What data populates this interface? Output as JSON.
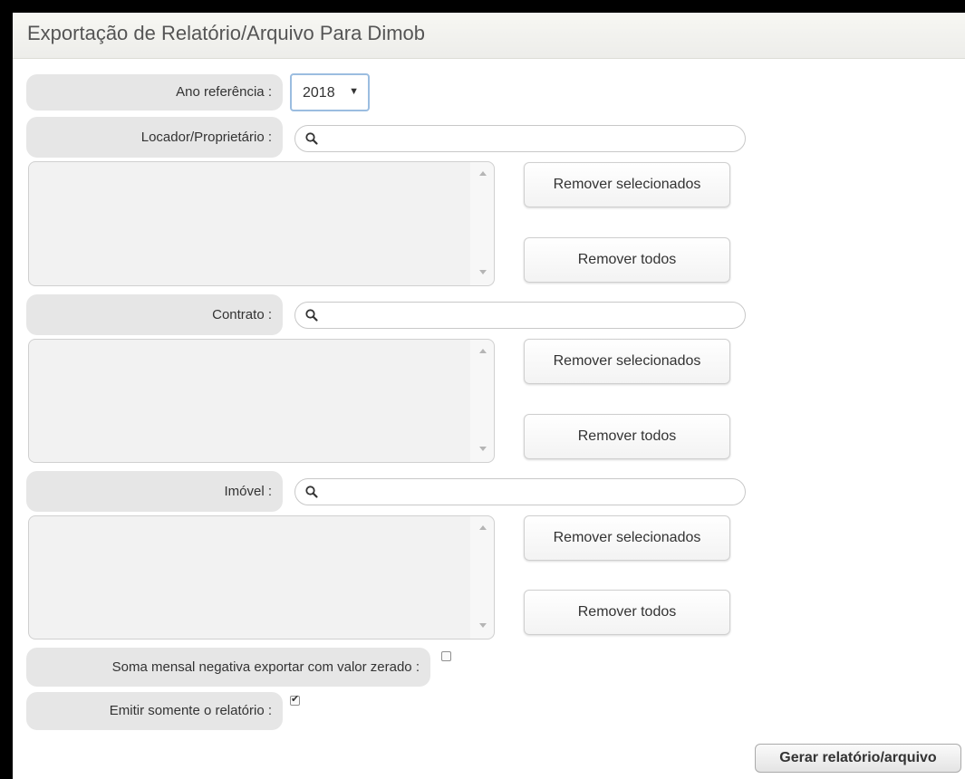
{
  "page": {
    "title": "Exportação de Relatório/Arquivo Para Dimob"
  },
  "ano": {
    "label": "Ano referência :",
    "selected": "2018",
    "arrow": "▼"
  },
  "locador": {
    "label": "Locador/Proprietário :",
    "search_value": "",
    "remove_selected": "Remover selecionados",
    "remove_all": "Remover todos"
  },
  "contrato": {
    "label": "Contrato :",
    "search_value": "",
    "remove_selected": "Remover selecionados",
    "remove_all": "Remover todos"
  },
  "imovel": {
    "label": "Imóvel :",
    "search_value": "",
    "remove_selected": "Remover selecionados",
    "remove_all": "Remover todos"
  },
  "soma_negativa": {
    "label": "Soma mensal negativa exportar com valor zerado :",
    "checked": false
  },
  "somente_relatorio": {
    "label": "Emitir somente o relatório :",
    "checked": true,
    "mark": "✔"
  },
  "actions": {
    "generate": "Gerar relatório/arquivo"
  }
}
